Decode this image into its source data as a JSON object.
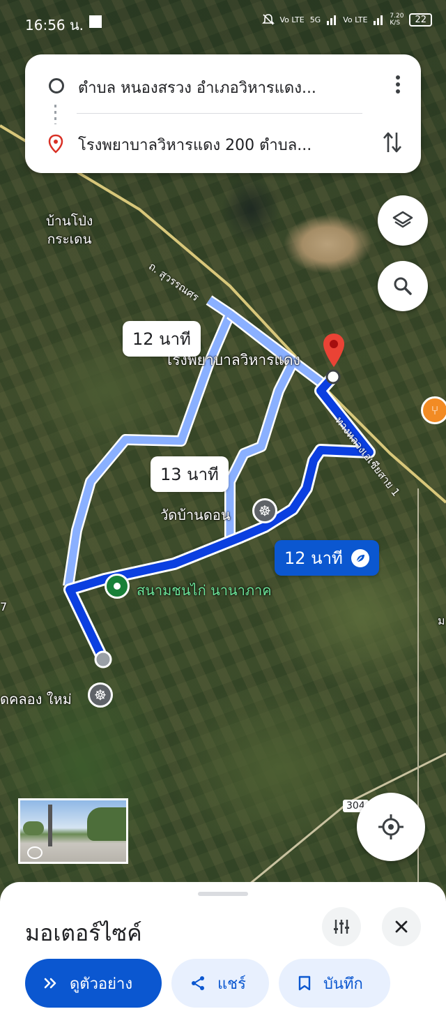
{
  "status_bar": {
    "time": "16:56 น.",
    "net_speed": "7.20\nK/S",
    "battery": "22",
    "signal_labels": [
      "Vo LTE",
      "5G",
      "Vo LTE"
    ]
  },
  "directions": {
    "origin": "ตำบล หนองสรวง อำเภอวิหารแดง...",
    "destination": "โรงพยาบาลวิหารแดง 200 ตำบล..."
  },
  "map": {
    "labels": {
      "village": "บ้านโป่ง\nกระเดน",
      "road": "ถ. สุวรรณศร",
      "highway": "ทางหลวงเอเชียสาย 1",
      "temple": "วัดบ้านดอน",
      "origin_place": "สนามชนไก่ นานาภาค",
      "temple2": "ดคลอง ใหม่",
      "destination_place": "โรงพยาบาลวิหารแดง",
      "road_number": "304",
      "edge_left": "7",
      "edge_right": "ม"
    },
    "route_times": {
      "alt1": "12 นาที",
      "alt2": "13 นาที",
      "selected": "12 นาที"
    },
    "colors": {
      "route_selected": "#0b3fe0",
      "route_alt": "#8ab0ff",
      "pin_red": "#ea4335",
      "pin_green": "#188038",
      "accent": "#0b57d0"
    }
  },
  "bottom_sheet": {
    "mode": "มอเตอร์ไซค์",
    "buttons": {
      "preview": "ดูตัวอย่าง",
      "share": "แชร์",
      "save": "บันทึก"
    }
  }
}
